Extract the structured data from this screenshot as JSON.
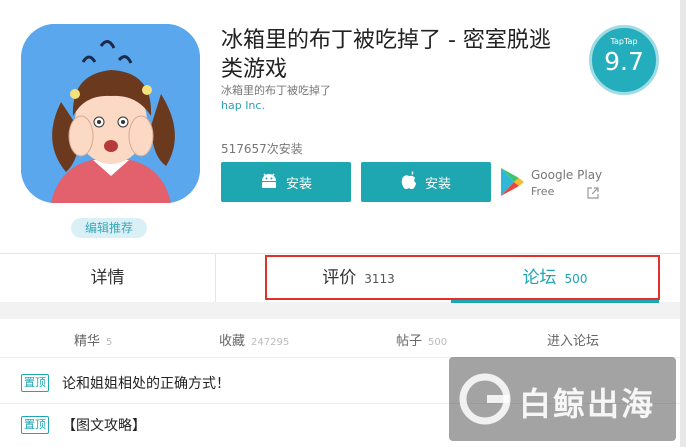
{
  "app": {
    "title": "冰箱里的布丁被吃掉了 - 密室脱逃类游戏",
    "subtitle": "冰箱里的布丁被吃掉了",
    "developer": "hap Inc.",
    "installs": "517657次安装",
    "editor_badge": "编辑推荐",
    "icon": "cartoon-girl-app-icon"
  },
  "score": {
    "brand": "TapTap",
    "value": "9.7"
  },
  "install_buttons": {
    "android_label": "安装",
    "apple_label": "安装",
    "android_icon": "android-icon",
    "apple_icon": "apple-icon"
  },
  "google_play": {
    "name": "Google Play",
    "price": "Free"
  },
  "tabs": {
    "details": "详情",
    "reviews": "评价",
    "reviews_count": "3113",
    "forum": "论坛",
    "forum_count": "500",
    "active": "forum"
  },
  "forum_stats": {
    "featured_label": "精华",
    "featured_count": "5",
    "favorites_label": "收藏",
    "favorites_count": "247295",
    "posts_label": "帖子",
    "posts_count": "500",
    "enter_label": "进入论坛"
  },
  "posts": [
    {
      "tag": "置顶",
      "title": "论和姐姐相处的正确方式！"
    },
    {
      "tag": "置顶",
      "title": "【图文攻略】"
    }
  ],
  "watermark": {
    "text": "白鲸出海"
  },
  "colors": {
    "accent": "#1ea6b1",
    "highlight": "#e0322b"
  }
}
